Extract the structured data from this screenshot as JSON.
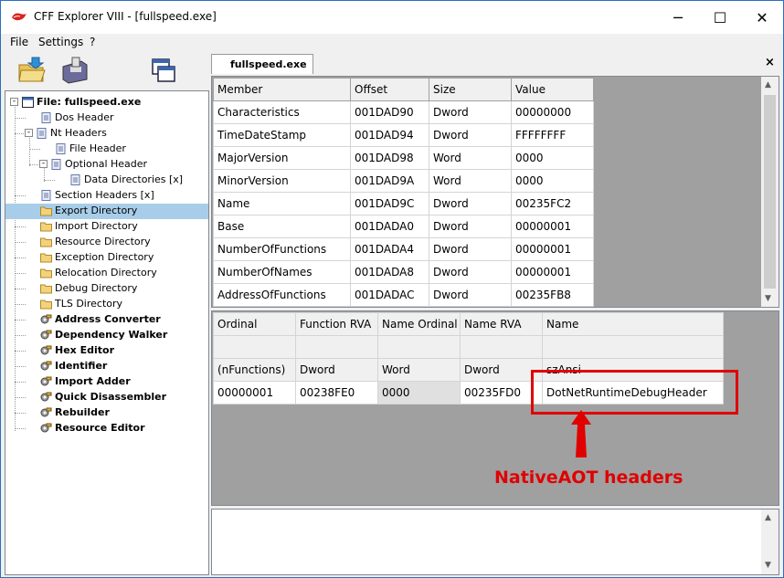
{
  "window": {
    "title": "CFF Explorer VIII - [fullspeed.exe]",
    "controls": {
      "minimize": "─",
      "maximize": "☐",
      "close": "✕"
    }
  },
  "menu": [
    "File",
    "Settings",
    "?"
  ],
  "tree": [
    {
      "label": "File: fullspeed.exe",
      "bold": true
    },
    {
      "label": "Dos Header"
    },
    {
      "label": "Nt Headers"
    },
    {
      "label": "File Header"
    },
    {
      "label": "Optional Header"
    },
    {
      "label": "Data Directories [x]"
    },
    {
      "label": "Section Headers [x]"
    },
    {
      "label": "Export Directory",
      "selected": true
    },
    {
      "label": "Import Directory"
    },
    {
      "label": "Resource Directory"
    },
    {
      "label": "Exception Directory"
    },
    {
      "label": "Relocation Directory"
    },
    {
      "label": "Debug Directory"
    },
    {
      "label": "TLS Directory"
    },
    {
      "label": "Address Converter",
      "bold": true
    },
    {
      "label": "Dependency Walker",
      "bold": true
    },
    {
      "label": "Hex Editor",
      "bold": true
    },
    {
      "label": "Identifier",
      "bold": true
    },
    {
      "label": "Import Adder",
      "bold": true
    },
    {
      "label": "Quick Disassembler",
      "bold": true
    },
    {
      "label": "Rebuilder",
      "bold": true
    },
    {
      "label": "Resource Editor",
      "bold": true
    }
  ],
  "tab": {
    "label": "fullspeed.exe",
    "close": "×"
  },
  "top_table": {
    "headers": [
      "Member",
      "Offset",
      "Size",
      "Value"
    ],
    "rows": [
      [
        "Characteristics",
        "001DAD90",
        "Dword",
        "00000000"
      ],
      [
        "TimeDateStamp",
        "001DAD94",
        "Dword",
        "FFFFFFFF"
      ],
      [
        "MajorVersion",
        "001DAD98",
        "Word",
        "0000"
      ],
      [
        "MinorVersion",
        "001DAD9A",
        "Word",
        "0000"
      ],
      [
        "Name",
        "001DAD9C",
        "Dword",
        "00235FC2"
      ],
      [
        "Base",
        "001DADA0",
        "Dword",
        "00000001"
      ],
      [
        "NumberOfFunctions",
        "001DADA4",
        "Dword",
        "00000001"
      ],
      [
        "NumberOfNames",
        "001DADA8",
        "Dword",
        "00000001"
      ],
      [
        "AddressOfFunctions",
        "001DADAC",
        "Dword",
        "00235FB8"
      ]
    ]
  },
  "bottom_table": {
    "headers": [
      "Ordinal",
      "Function RVA",
      "Name Ordinal",
      "Name RVA",
      "Name"
    ],
    "blank_row": [
      "",
      "",
      "",
      "",
      ""
    ],
    "type_row": [
      "(nFunctions)",
      "Dword",
      "Word",
      "Dword",
      "szAnsi"
    ],
    "data_row": [
      "00000001",
      "00238FE0",
      "0000",
      "00235FD0",
      "DotNetRuntimeDebugHeader"
    ]
  },
  "annotation": {
    "text": "NativeAOT headers",
    "color": "#e00000"
  },
  "colors": {
    "selection": "#a8cde9",
    "grid_bg": "#a0a0a0",
    "accent_border": "#2b6fbf"
  }
}
